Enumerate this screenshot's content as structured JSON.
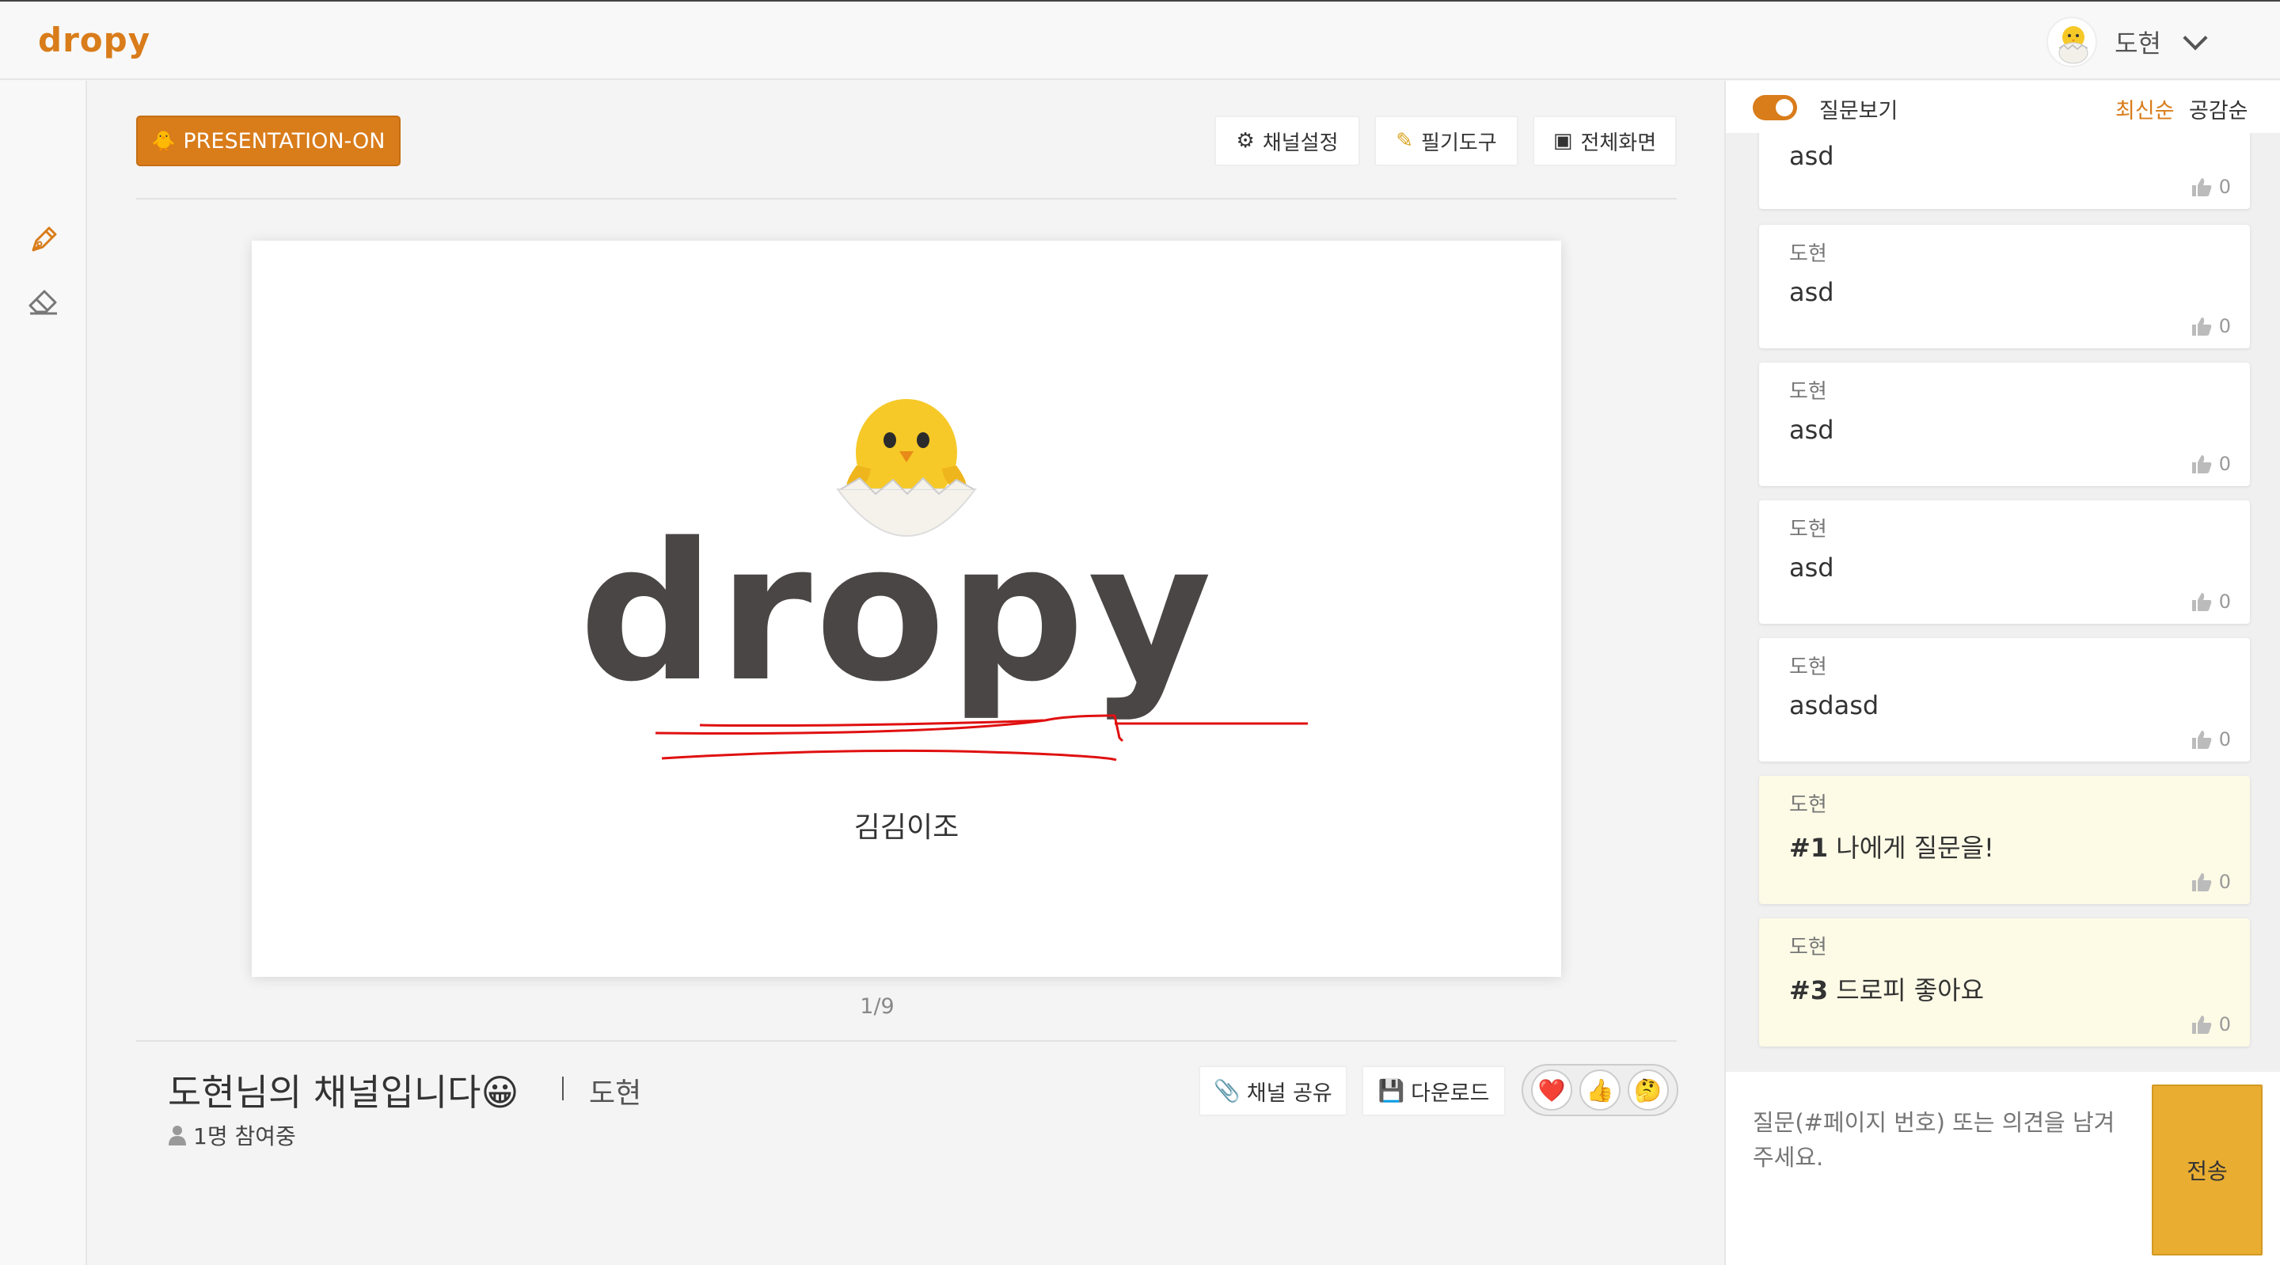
{
  "header": {
    "logo": "dropy",
    "user_name": "도현"
  },
  "toolbar": {
    "presentation_label": "PRESENTATION-ON",
    "channel_settings": "채널설정",
    "pen_tool": "필기도구",
    "fullscreen": "전체화면"
  },
  "slide": {
    "title_word": "dropy",
    "subtitle": "김김이조",
    "page_indicator": "1/9"
  },
  "channel": {
    "title": "도현님의 채널입니다😀",
    "owner": "도현",
    "participants": "1명 참여중",
    "share_label": "채널 공유",
    "download_label": "다운로드",
    "reactions": [
      "❤️",
      "👍",
      "🤔"
    ]
  },
  "panel": {
    "toggle_label": "질문보기",
    "sort_newest": "최신순",
    "sort_likes": "공감순",
    "questions": [
      {
        "author": "",
        "text": "asd",
        "likes": "0"
      },
      {
        "author": "도현",
        "text": "asd",
        "likes": "0"
      },
      {
        "author": "도현",
        "text": "asd",
        "likes": "0"
      },
      {
        "author": "도현",
        "text": "asd",
        "likes": "0"
      },
      {
        "author": "도현",
        "text": "asdasd",
        "likes": "0"
      },
      {
        "author": "도현",
        "tag": "#1",
        "text": "나에게 질문을!",
        "likes": "0"
      },
      {
        "author": "도현",
        "tag": "#3",
        "text": "드로피 좋아요",
        "likes": "0"
      }
    ],
    "input_placeholder": "질문(#페이지 번호) 또는 의견을 남겨주세요.",
    "send_label": "전송"
  },
  "colors": {
    "brand": "#d97c1a",
    "send": "#e8ad31",
    "highlight_card": "#fdfbe6",
    "annotation_ink": "#e01010"
  }
}
